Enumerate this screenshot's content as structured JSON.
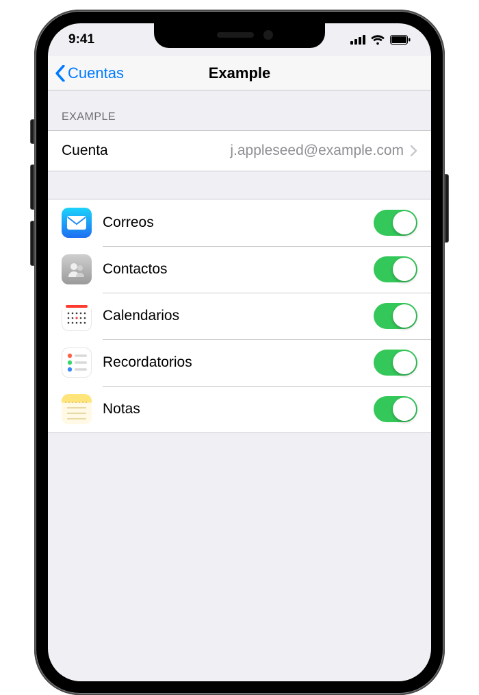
{
  "status": {
    "time": "9:41"
  },
  "nav": {
    "back": "Cuentas",
    "title": "Example"
  },
  "section_header": "EXAMPLE",
  "account_row": {
    "label": "Cuenta",
    "value": "j.appleseed@example.com"
  },
  "services": [
    {
      "id": "mail",
      "label": "Correos",
      "icon": "mail-icon",
      "on": true
    },
    {
      "id": "contacts",
      "label": "Contactos",
      "icon": "contacts-icon",
      "on": true
    },
    {
      "id": "calendar",
      "label": "Calendarios",
      "icon": "calendar-icon",
      "on": true
    },
    {
      "id": "reminders",
      "label": "Recordatorios",
      "icon": "reminders-icon",
      "on": true
    },
    {
      "id": "notes",
      "label": "Notas",
      "icon": "notes-icon",
      "on": true
    }
  ],
  "colors": {
    "tint": "#007aff",
    "toggle_on": "#34c759"
  }
}
